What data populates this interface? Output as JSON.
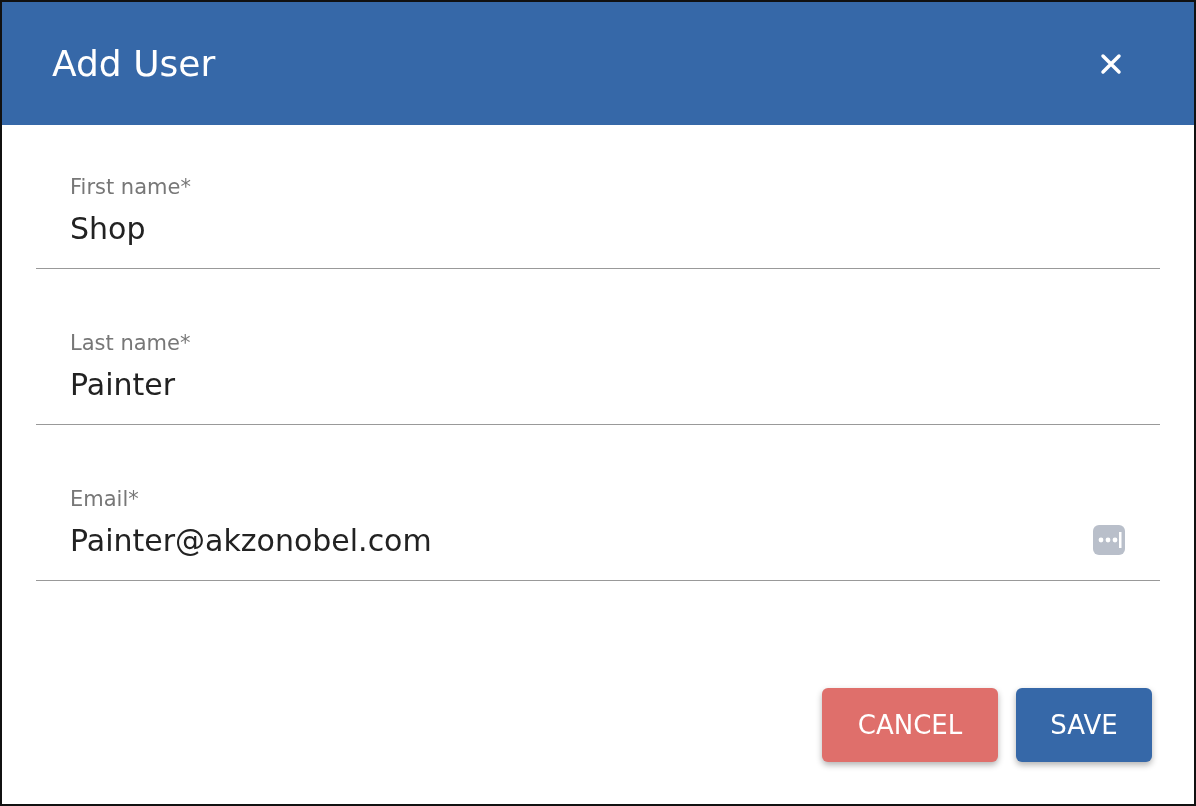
{
  "dialog": {
    "title": "Add User"
  },
  "fields": [
    {
      "kind": "text",
      "label": "First name*",
      "value": "Shop"
    },
    {
      "kind": "text",
      "label": "Last name*",
      "value": "Painter"
    },
    {
      "kind": "autofill",
      "label": "Email*",
      "value": "Painter@akzonobel.com"
    }
  ],
  "buttons": [
    {
      "kind": "cancel",
      "label": "CANCEL"
    },
    {
      "kind": "primary",
      "label": "SAVE"
    }
  ]
}
